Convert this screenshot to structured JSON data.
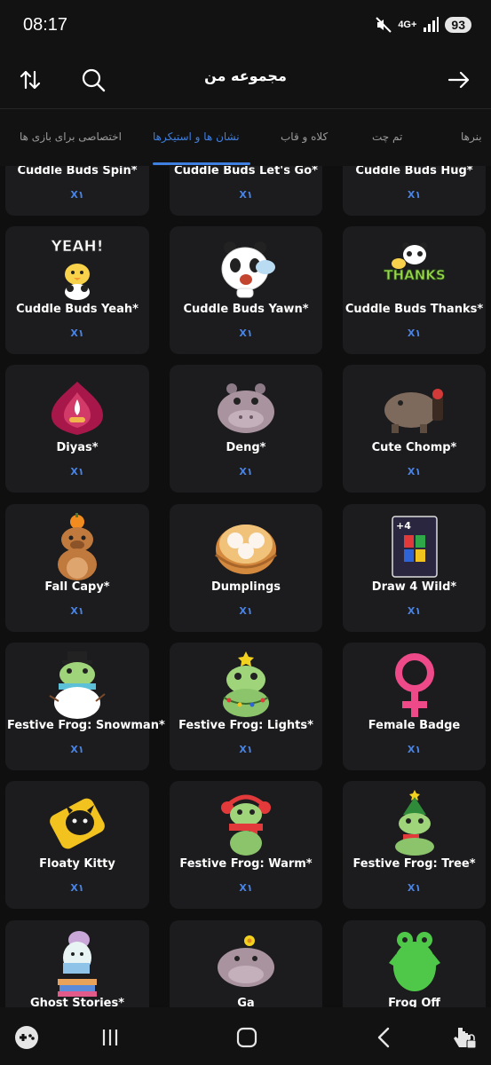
{
  "status": {
    "time": "08:17",
    "network": "4G+",
    "battery": "93"
  },
  "header": {
    "title": "مجموعه من"
  },
  "tabs": [
    {
      "label": "اختصاصی برای بازی ها",
      "active": false
    },
    {
      "label": "نشان ها و استیکرها",
      "active": true
    },
    {
      "label": "کلاه و قاب",
      "active": false
    },
    {
      "label": "تم چت",
      "active": false
    },
    {
      "label": "بنرها",
      "active": false
    }
  ],
  "items": [
    {
      "name": "Cuddle Buds Spin*",
      "qty": "X۱",
      "icon": "panda-duck-spin"
    },
    {
      "name": "Cuddle Buds Let's Go*",
      "qty": "X۱",
      "icon": "panda-duck-go"
    },
    {
      "name": "Cuddle Buds Hug*",
      "qty": "X۱",
      "icon": "panda-duck-hug"
    },
    {
      "name": "Cuddle Buds Yeah*",
      "qty": "X۱",
      "icon": "panda-duck-yeah"
    },
    {
      "name": "Cuddle Buds Yawn*",
      "qty": "X۱",
      "icon": "panda-yawn"
    },
    {
      "name": "Cuddle Buds Thanks*",
      "qty": "X۱",
      "icon": "panda-duck-thanks"
    },
    {
      "name": "Diyas*",
      "qty": "X۱",
      "icon": "diya-lamp"
    },
    {
      "name": "Deng*",
      "qty": "X۱",
      "icon": "hippo"
    },
    {
      "name": "Cute Chomp*",
      "qty": "X۱",
      "icon": "hippo-chomp"
    },
    {
      "name": "Fall Capy*",
      "qty": "X۱",
      "icon": "capybara"
    },
    {
      "name": "Dumplings",
      "qty": "X۱",
      "icon": "dumplings"
    },
    {
      "name": "Draw 4 Wild*",
      "qty": "X۱",
      "icon": "draw-four-card"
    },
    {
      "name": "Festive Frog: Snowman*",
      "qty": "X۱",
      "icon": "frog-snowman"
    },
    {
      "name": "Festive Frog: Lights*",
      "qty": "X۱",
      "icon": "frog-lights"
    },
    {
      "name": "Female Badge",
      "qty": "X۱",
      "icon": "female-symbol"
    },
    {
      "name": "Floaty Kitty",
      "qty": "X۱",
      "icon": "kitty-float"
    },
    {
      "name": "Festive Frog: Warm*",
      "qty": "X۱",
      "icon": "frog-warm"
    },
    {
      "name": "Festive Frog: Tree*",
      "qty": "X۱",
      "icon": "frog-tree"
    },
    {
      "name": "Ghost Stories*",
      "qty": "X۱",
      "icon": "ghost-reading"
    },
    {
      "name": "Ga",
      "qty": "X۱",
      "icon": "hippo-flower"
    },
    {
      "name": "Frog Off",
      "qty": "X۱",
      "icon": "green-frog"
    }
  ],
  "colors": {
    "accent": "#3f7fe0",
    "background": "#0f0f10",
    "card": "#1c1c1e"
  }
}
